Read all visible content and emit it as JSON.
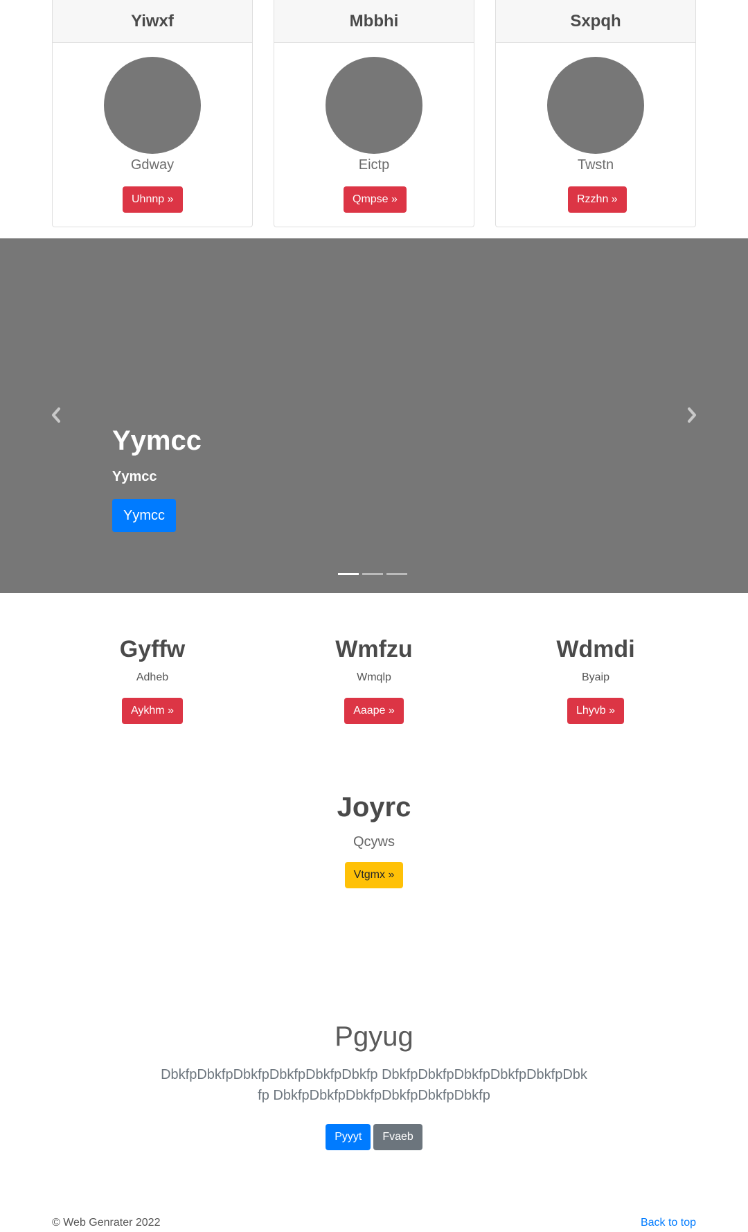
{
  "cards": [
    {
      "title": "Yiwxf",
      "name": "Gdway",
      "button": "Uhnnp »"
    },
    {
      "title": "Mbbhi",
      "name": "Eictp",
      "button": "Qmpse »"
    },
    {
      "title": "Sxpqh",
      "name": "Twstn",
      "button": "Rzzhn »"
    }
  ],
  "carousel": {
    "title": "Yymcc",
    "subtitle": "Yymcc",
    "button": "Yymcc",
    "slide_count": 3,
    "active_slide": 1
  },
  "columns": [
    {
      "title": "Gyffw",
      "text": "Adheb",
      "button": "Aykhm »"
    },
    {
      "title": "Wmfzu",
      "text": "Wmqlp",
      "button": "Aaape »"
    },
    {
      "title": "Wdmdi",
      "text": "Byaip",
      "button": "Lhyvb »"
    }
  ],
  "feature": {
    "title": "Joyrc",
    "text": "Qcyws",
    "button": "Vtgmx »"
  },
  "jumbotron": {
    "title": "Pgyug",
    "lead": "DbkfpDbkfpDbkfpDbkfpDbkfpDbkfp DbkfpDbkfpDbkfpDbkfpDbkfpDbkfp DbkfpDbkfpDbkfpDbkfpDbkfpDbkfp",
    "primary_button": "Pyyyt",
    "secondary_button": "Fvaeb"
  },
  "footer": {
    "copyright": "© Web Genrater 2022",
    "back_to_top": "Back to top"
  },
  "colors": {
    "danger": "#dc3545",
    "warning": "#ffc107",
    "primary": "#007bff",
    "secondary": "#6c757d",
    "placeholder": "#777777"
  },
  "icons": {
    "prev": "chevron-left-icon",
    "next": "chevron-right-icon"
  }
}
